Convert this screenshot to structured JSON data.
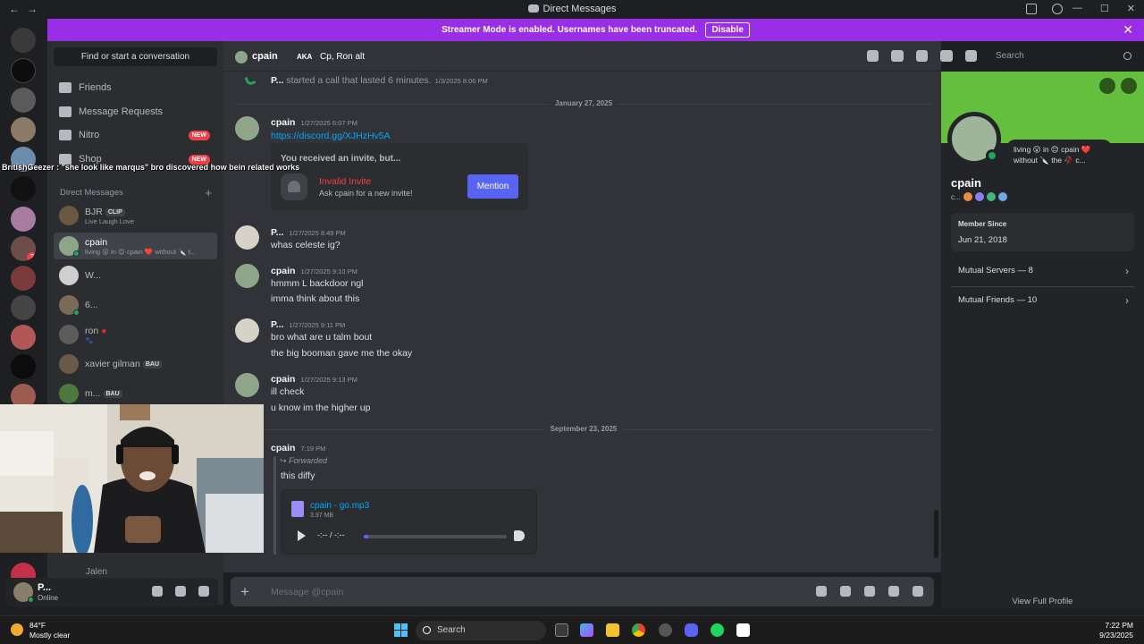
{
  "window": {
    "title": "Direct Messages"
  },
  "banner": {
    "text": "Streamer Mode is enabled. Usernames have been truncated.",
    "disable_label": "Disable",
    "close_glyph": "✕"
  },
  "sidebar": {
    "find_label": "Find or start a conversation",
    "nav": [
      {
        "label": "Friends",
        "icon": "friends-icon"
      },
      {
        "label": "Message Requests",
        "icon": "mail-icon"
      },
      {
        "label": "Nitro",
        "icon": "nitro-icon",
        "badge": "NEW"
      },
      {
        "label": "Shop",
        "icon": "shop-icon",
        "badge": "NEW"
      }
    ],
    "dm_header": "Direct Messages",
    "dm_add": "+",
    "dms": [
      {
        "name": "BJR",
        "tag": "CLIP",
        "sub": "Live Laugh Love"
      },
      {
        "name": "cpain",
        "sub": "living 😮 in 😊 cpain ❤️ without 🔪 t..."
      },
      {
        "name": "W..."
      },
      {
        "name": "6..."
      },
      {
        "name": "ron",
        "sub": "🐾"
      },
      {
        "name": "xavier gilman",
        "tag": "BAU"
      },
      {
        "name": "m...",
        "tag": "BAU"
      }
    ],
    "hidden_dm": "Jalen"
  },
  "overlay": {
    "caption": "BritishGeezer : \"she look like marqus\" bro discovered how bein related works"
  },
  "user": {
    "name": "P...",
    "status": "Online"
  },
  "chat_header": {
    "name": "cpain",
    "aka_label": "AKA",
    "aka_value": "Cp, Ron alt",
    "search_placeholder": "Search"
  },
  "chat": {
    "call": {
      "author": "P...",
      "text": "started a call that lasted 6 minutes.",
      "ts": "1/3/2025 8:06 PM"
    },
    "divider1": "January 27, 2025",
    "divider2": "September 23, 2025",
    "messages": [
      {
        "author": "cpain",
        "ts": "1/27/2025 6:07 PM",
        "lines": [
          "https://discord.gg/XJHzHv5A"
        ]
      },
      {
        "author": "P...",
        "ts": "1/27/2025 8:49 PM",
        "lines": [
          "whas celeste ig?"
        ]
      },
      {
        "author": "cpain",
        "ts": "1/27/2025 9:10 PM",
        "lines": [
          "hmmm L backdoor ngl",
          "imma think about this"
        ]
      },
      {
        "author": "P...",
        "ts": "1/27/2025 9:11 PM",
        "lines": [
          "bro what are u talm bout",
          "the big booman gave me the okay"
        ]
      },
      {
        "author": "cpain",
        "ts": "1/27/2025 9:13 PM",
        "lines": [
          "ill check",
          "u know im the higher up"
        ]
      },
      {
        "author": "cpain",
        "ts": "7:19 PM",
        "lines": []
      }
    ],
    "invite": {
      "header": "You received an invite, but...",
      "title": "Invalid Invite",
      "subtitle": "Ask cpain for a new invite!",
      "button": "Mention"
    },
    "forward": {
      "label": "Forwarded",
      "text": "this diffy",
      "file_name": "cpain - go.mp3",
      "file_size": "3.97 MB",
      "time": "-:-- / -:--",
      "progress": 0.03
    },
    "composer_placeholder": "Message @cpain"
  },
  "profile": {
    "name": "cpain",
    "tag": "c...",
    "status_line1": "living 😮 in 😊 cpain ❤️",
    "status_line2": "without 🔪 the 🥀 c...",
    "member_since_label": "Member Since",
    "member_since": "Jun 21, 2018",
    "mutual_servers": "Mutual Servers — 8",
    "mutual_friends": "Mutual Friends — 10",
    "view_full": "View Full Profile",
    "banner_color": "#65bf3f"
  },
  "taskbar": {
    "temp": "84°F",
    "weather": "Mostly clear",
    "search": "Search",
    "time": "7:22 PM",
    "date": "9/23/2025"
  }
}
